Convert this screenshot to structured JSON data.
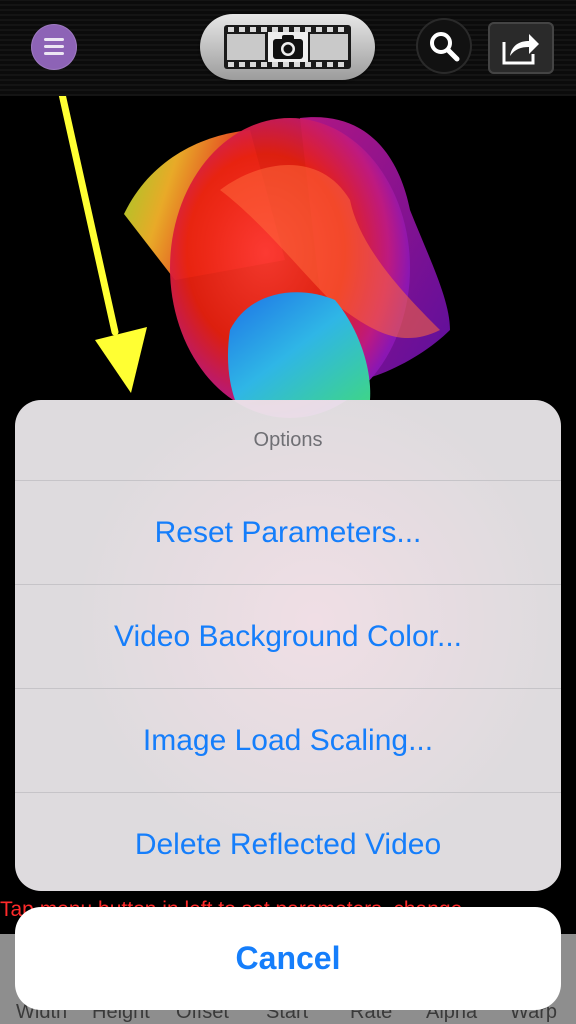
{
  "toolbar": {
    "menu_icon": "menu-icon",
    "camera_icon": "camera-icon",
    "search_icon": "search-icon",
    "share_icon": "share-icon",
    "menu_color": "#8d63b6"
  },
  "hint_text": "Tap menu button in left to set parameters, change",
  "parameter_bar": {
    "labels": [
      "Width",
      "Height",
      "Offset",
      "Start",
      "Rate",
      "Alpha",
      "Warp"
    ]
  },
  "action_sheet": {
    "title": "Options",
    "items": [
      "Reset Parameters...",
      "Video Background Color...",
      "Image Load Scaling...",
      "Delete Reflected Video"
    ],
    "cancel_label": "Cancel",
    "accent_color": "#157efb"
  },
  "annotation": {
    "arrow_color": "#ffff33"
  }
}
